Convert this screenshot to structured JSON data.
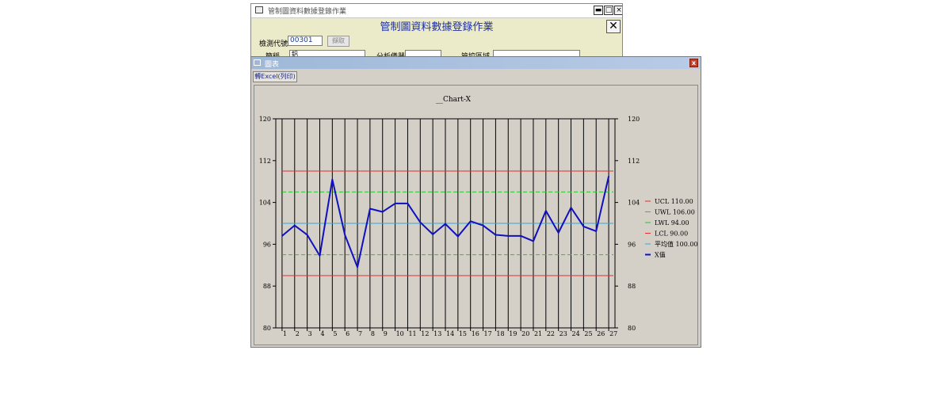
{
  "bg_window": {
    "title": "管制圖資料數據登錄作業",
    "header": "管制圖資料數據登錄作業",
    "min_label": "▬",
    "max_label": "□",
    "close_label": "×",
    "big_close_label": "✕",
    "code_label": "檢測代號",
    "code_value": "00301",
    "fetch_label": "擷取",
    "name_label": "簡稱",
    "name_value": "鋁",
    "instrument_label": "分析儀器",
    "range_label": "管控區域"
  },
  "chart_window": {
    "title": "圖表",
    "close_label": "x",
    "excel_button": "轉Excel(列印)"
  },
  "chart_data": {
    "type": "line",
    "title": "__Chart-X",
    "ylim": [
      80,
      120
    ],
    "yticks": [
      "120",
      "112",
      "104",
      "96",
      "88",
      "80"
    ],
    "ytick_values": [
      120,
      112,
      104,
      96,
      88,
      80
    ],
    "categories": [
      "1",
      "2",
      "3",
      "4",
      "5",
      "6",
      "7",
      "8",
      "9",
      "10",
      "11",
      "12",
      "13",
      "14",
      "15",
      "16",
      "17",
      "18",
      "19",
      "20",
      "21",
      "22",
      "23",
      "24",
      "25",
      "26",
      "27"
    ],
    "control_lines": [
      {
        "name": "UCL 110.00",
        "value": 110,
        "color": "#e03030",
        "dashed": false
      },
      {
        "name": "UWL 106.00",
        "value": 106,
        "color": "#30c030",
        "dashed": true
      },
      {
        "name": "LWL 94.00",
        "value": 94,
        "color": "#30c030",
        "dashed": true
      },
      {
        "name": "LCL 90.00",
        "value": 90,
        "color": "#e03030",
        "dashed": false
      },
      {
        "name": "平均值 100.00",
        "value": 100,
        "color": "#30a8d8",
        "dashed": false
      }
    ],
    "series": [
      {
        "name": "X值",
        "color": "#1010c0",
        "values": [
          97.6,
          99.6,
          97.8,
          93.8,
          108.4,
          97.8,
          91.6,
          102.8,
          102.2,
          103.8,
          103.8,
          100.2,
          97.9,
          99.9,
          97.5,
          100.4,
          99.6,
          97.8,
          97.6,
          97.6,
          96.6,
          102.4,
          98.2,
          103.0,
          99.4,
          98.5,
          109.0
        ]
      }
    ],
    "grid": true,
    "legend": "right"
  }
}
